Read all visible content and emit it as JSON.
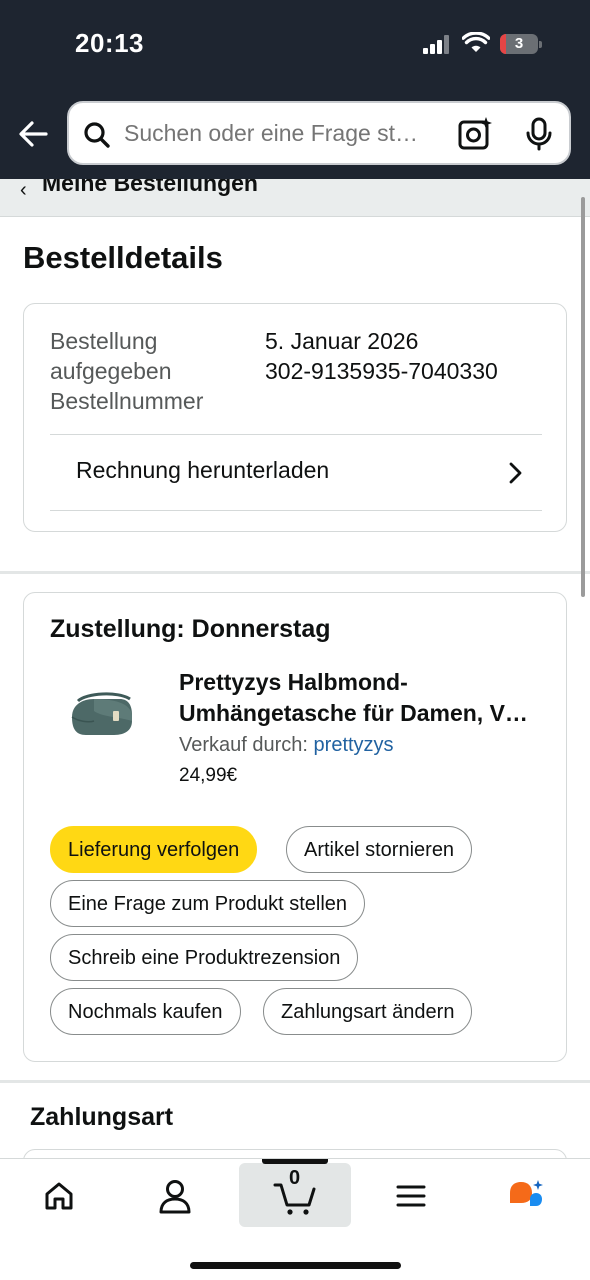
{
  "status_bar": {
    "time": "20:13",
    "battery": "3"
  },
  "header": {
    "search_placeholder": "Suchen oder eine Frage st…"
  },
  "breadcrumb": {
    "label": "Meine Bestellungen"
  },
  "page": {
    "title": "Bestelldetails"
  },
  "order": {
    "labels": [
      "Bestellung",
      "aufgegeben",
      "Bestellnummer"
    ],
    "date": "5. Januar 2026",
    "number": "302-9135935-7040330",
    "invoice_label": "Rechnung herunterladen"
  },
  "delivery": {
    "title": "Zustellung: Donnerstag",
    "product_name_line1": "Prettyzys Halbmond-",
    "product_name_line2": "Umhängetasche für Damen, V…",
    "seller_prefix": "Verkauf durch: ",
    "seller_name": "prettyzys",
    "price": "24,99€",
    "actions": {
      "track": "Lieferung verfolgen",
      "cancel": "Artikel stornieren",
      "ask": "Eine Frage zum Produkt stellen",
      "review": "Schreib eine Produktrezension",
      "buy_again": "Nochmals kaufen",
      "change_payment": "Zahlungsart ändern"
    }
  },
  "payment": {
    "title": "Zahlungsart"
  },
  "bottom_nav": {
    "cart_count": "0",
    "items": [
      "home-icon",
      "account-icon",
      "cart-icon",
      "menu-icon",
      "rufus-icon"
    ]
  },
  "colors": {
    "header_bg": "#1e2530",
    "primary_button": "#ffd814",
    "link": "#2162a1"
  }
}
